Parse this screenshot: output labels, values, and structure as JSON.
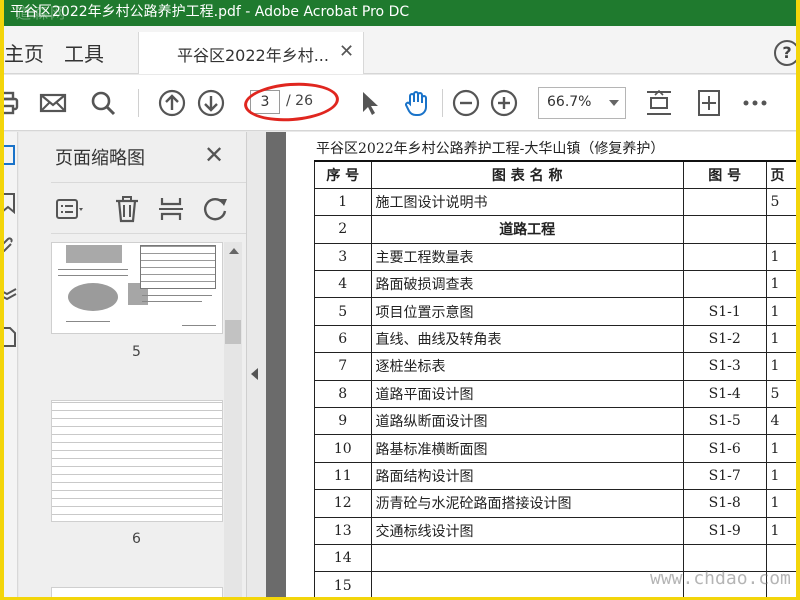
{
  "window": {
    "title": "平谷区2022年乡村公路养护工程.pdf - Adobe Acrobat Pro DC",
    "watermark_topleft": "道森网",
    "watermark_bottomright": "www.chdao.com"
  },
  "tabs": {
    "home": "主页",
    "tools": "工具",
    "document": "平谷区2022年乡村...",
    "close": "✕",
    "help": "?"
  },
  "toolbar": {
    "current_page": "3",
    "total_pages": "/ 26",
    "zoom": "66.7%"
  },
  "thumbnail_panel": {
    "title": "页面缩略图",
    "close": "✕",
    "thumbnails": [
      {
        "page": "5"
      },
      {
        "page": "6"
      }
    ]
  },
  "document": {
    "heading": "平谷区2022年乡村公路养护工程-大华山镇（修复养护）",
    "columns": [
      "序 号",
      "图 表 名 称",
      "图 号",
      "页"
    ],
    "rows": [
      {
        "no": "1",
        "name": "施工图设计说明书",
        "fig": "",
        "page": "5",
        "bold": false
      },
      {
        "no": "2",
        "name": "道路工程",
        "fig": "",
        "page": "",
        "bold": true
      },
      {
        "no": "3",
        "name": "主要工程数量表",
        "fig": "",
        "page": "1",
        "bold": false
      },
      {
        "no": "4",
        "name": "路面破损调查表",
        "fig": "",
        "page": "1",
        "bold": false
      },
      {
        "no": "5",
        "name": "项目位置示意图",
        "fig": "S1-1",
        "page": "1",
        "bold": false
      },
      {
        "no": "6",
        "name": "直线、曲线及转角表",
        "fig": "S1-2",
        "page": "1",
        "bold": false
      },
      {
        "no": "7",
        "name": "逐桩坐标表",
        "fig": "S1-3",
        "page": "1",
        "bold": false
      },
      {
        "no": "8",
        "name": "道路平面设计图",
        "fig": "S1-4",
        "page": "5",
        "bold": false
      },
      {
        "no": "9",
        "name": "道路纵断面设计图",
        "fig": "S1-5",
        "page": "4",
        "bold": false
      },
      {
        "no": "10",
        "name": "路基标准横断面图",
        "fig": "S1-6",
        "page": "1",
        "bold": false
      },
      {
        "no": "11",
        "name": "路面结构设计图",
        "fig": "S1-7",
        "page": "1",
        "bold": false
      },
      {
        "no": "12",
        "name": "沥青砼与水泥砼路面搭接设计图",
        "fig": "S1-8",
        "page": "1",
        "bold": false
      },
      {
        "no": "13",
        "name": "交通标线设计图",
        "fig": "S1-9",
        "page": "1",
        "bold": false
      },
      {
        "no": "14",
        "name": "",
        "fig": "",
        "page": "",
        "bold": false
      },
      {
        "no": "15",
        "name": "",
        "fig": "",
        "page": "",
        "bold": false
      }
    ]
  }
}
